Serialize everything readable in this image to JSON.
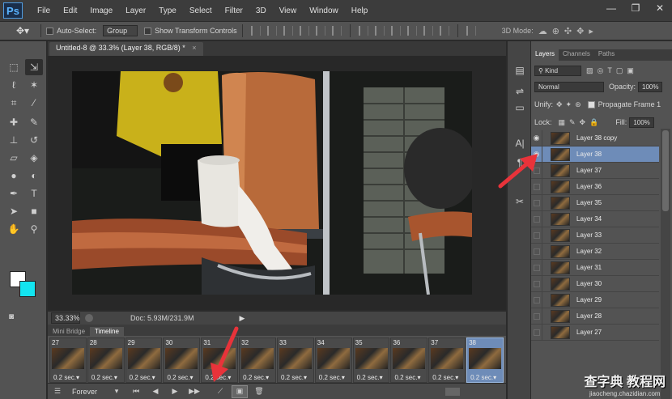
{
  "app": {
    "logo": "Ps"
  },
  "menu": [
    "File",
    "Edit",
    "Image",
    "Layer",
    "Type",
    "Select",
    "Filter",
    "3D",
    "View",
    "Window",
    "Help"
  ],
  "window_controls": [
    "—",
    "❐",
    "✕"
  ],
  "options_bar": {
    "auto_select_label": "Auto-Select:",
    "auto_select_value": "Group",
    "transform_controls_label": "Show Transform Controls",
    "mode_3d_label": "3D Mode:"
  },
  "document": {
    "tab_title": "Untitled-8 @ 33.3% (Layer 38, RGB/8) *",
    "zoom": "33.33%",
    "doc_size": "Doc: 5.93M/231.9M"
  },
  "timeline": {
    "tabs": [
      "Mini Bridge",
      "Timeline"
    ],
    "active_tab": "Timeline",
    "frames": [
      {
        "num": "27",
        "delay": "0.2 sec.▾"
      },
      {
        "num": "28",
        "delay": "0.2 sec.▾"
      },
      {
        "num": "29",
        "delay": "0.2 sec.▾"
      },
      {
        "num": "30",
        "delay": "0.2 sec.▾"
      },
      {
        "num": "31",
        "delay": "0.2 sec.▾"
      },
      {
        "num": "32",
        "delay": "0.2 sec.▾"
      },
      {
        "num": "33",
        "delay": "0.2 sec.▾"
      },
      {
        "num": "34",
        "delay": "0.2 sec.▾"
      },
      {
        "num": "35",
        "delay": "0.2 sec.▾"
      },
      {
        "num": "36",
        "delay": "0.2 sec.▾"
      },
      {
        "num": "37",
        "delay": "0.2 sec.▾"
      },
      {
        "num": "38",
        "delay": "0.2 sec.▾"
      }
    ],
    "selected_frame": "38",
    "loop": "Forever"
  },
  "layers_panel": {
    "tabs": [
      "Layers",
      "Channels",
      "Paths"
    ],
    "active_tab": "Layers",
    "kind_label": "Kind",
    "blend_mode": "Normal",
    "opacity_label": "Opacity:",
    "opacity_value": "100%",
    "unify_label": "Unify:",
    "propagate_label": "Propagate Frame 1",
    "lock_label": "Lock:",
    "fill_label": "Fill:",
    "fill_value": "100%",
    "layers": [
      {
        "name": "Layer 38 copy",
        "visible": true
      },
      {
        "name": "Layer 38",
        "visible": true,
        "selected": true
      },
      {
        "name": "Layer 37",
        "visible": false
      },
      {
        "name": "Layer 36",
        "visible": false
      },
      {
        "name": "Layer 35",
        "visible": false
      },
      {
        "name": "Layer 34",
        "visible": false
      },
      {
        "name": "Layer 33",
        "visible": false
      },
      {
        "name": "Layer 32",
        "visible": false
      },
      {
        "name": "Layer 31",
        "visible": false
      },
      {
        "name": "Layer 30",
        "visible": false
      },
      {
        "name": "Layer 29",
        "visible": false
      },
      {
        "name": "Layer 28",
        "visible": false
      },
      {
        "name": "Layer 27",
        "visible": false
      }
    ]
  },
  "watermark": {
    "text": "查字典 教程网",
    "url": "jiaocheng.chazidian.com"
  },
  "colors": {
    "foreground": "#ffffff",
    "background": "#13e5f0",
    "selection": "#6e8cb8",
    "arrow": "#e8333a"
  }
}
